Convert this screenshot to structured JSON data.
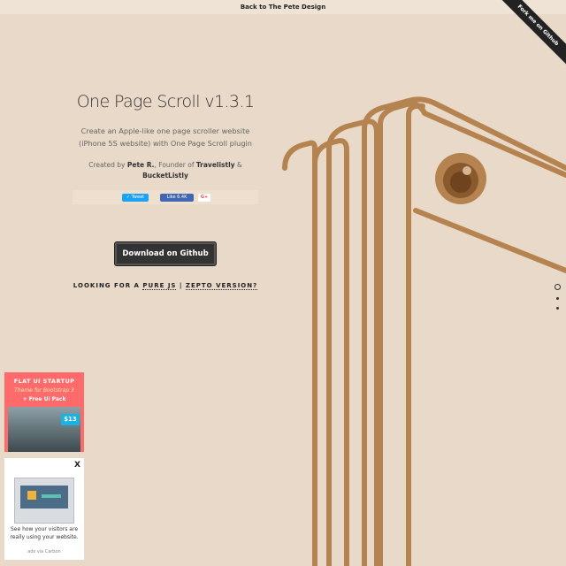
{
  "topbar": {
    "link": "Back to The Pete Design"
  },
  "ribbon": {
    "label": "Fork me on Github"
  },
  "hero": {
    "title": "One Page Scroll v1.3.1",
    "subtitle_line1": "Create an Apple-like one page scroller website",
    "subtitle_line2": "(iPhone 5S website) with One Page Scroll plugin",
    "credit_prefix": "Created by ",
    "credit_name": "Pete R.",
    "credit_mid": ", Founder of ",
    "credit_company1": "Travelistly",
    "credit_amp": " &",
    "credit_company2": "BucketListly"
  },
  "social": {
    "tweet": "Tweet",
    "like": "Like 6.4K",
    "plus": "G+"
  },
  "actions": {
    "download": "Download on Github",
    "pure_prefix": "LOOKING FOR A ",
    "pure_js": "PURE JS",
    "separator": " | ",
    "zepto": "ZEPTO VERSION?"
  },
  "pagination": {
    "count": 3,
    "active_index": 0
  },
  "ads": {
    "flat_ui": {
      "line1": "FLAT UI STARTUP",
      "line2": "Theme for Bootstrap 3",
      "line3": "+ Free Ui Pack",
      "price": "$13"
    },
    "carbon": {
      "close": "X",
      "text": "See how your visitors are really using your website.",
      "via": "ads via Carbon"
    }
  },
  "colors": {
    "background": "#e8d9c8",
    "phone_outline": "#b5834f",
    "camera": "#8a5a2e",
    "button": "#333333",
    "ribbon": "#222222"
  }
}
